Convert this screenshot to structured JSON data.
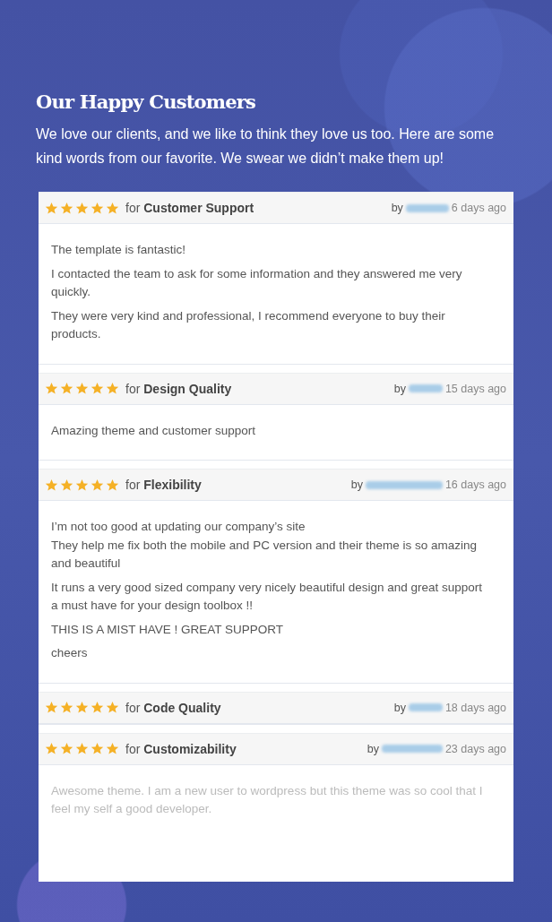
{
  "heading": "Our Happy Customers",
  "intro": "We love our clients, and we like to think they love us too. Here are some kind words from our favorite. We swear we didn’t make them up!",
  "reviews": [
    {
      "stars": 5,
      "for_label": "for",
      "category": "Customer Support",
      "by_label": "by",
      "age": "6 days ago",
      "faded": false,
      "paragraphs": [
        [
          "The template is fantastic!"
        ],
        [
          "I contacted the team to ask for some information and they answered me very quickly."
        ],
        [
          "They were very kind and professional, I recommend everyone to buy their products."
        ]
      ]
    },
    {
      "stars": 5,
      "for_label": "for",
      "category": "Design Quality",
      "by_label": "by",
      "age": "15 days ago",
      "faded": false,
      "paragraphs": [
        [
          "Amazing theme and customer support"
        ]
      ]
    },
    {
      "stars": 5,
      "for_label": "for",
      "category": "Flexibility",
      "by_label": "by",
      "age": "16 days ago",
      "faded": false,
      "paragraphs": [
        [
          "I’m not too good at updating our company’s site",
          "They help me fix both the mobile and PC version and their theme is so amazing and beautiful"
        ],
        [
          "It runs a very good sized company very nicely beautiful design and great support a must have for your design toolbox !!"
        ],
        [
          "THIS IS A MIST HAVE ! GREAT SUPPORT"
        ],
        [
          "cheers"
        ]
      ]
    },
    {
      "stars": 5,
      "for_label": "for",
      "category": "Code Quality",
      "by_label": "by",
      "age": "18 days ago"
    },
    {
      "stars": 5,
      "for_label": "for",
      "category": "Customizability",
      "by_label": "by",
      "age": "23 days ago",
      "faded": true,
      "paragraphs": [
        [
          "Awesome theme. I am a new user to wordpress but this theme was so cool that I feel my self a good developer."
        ]
      ]
    }
  ]
}
